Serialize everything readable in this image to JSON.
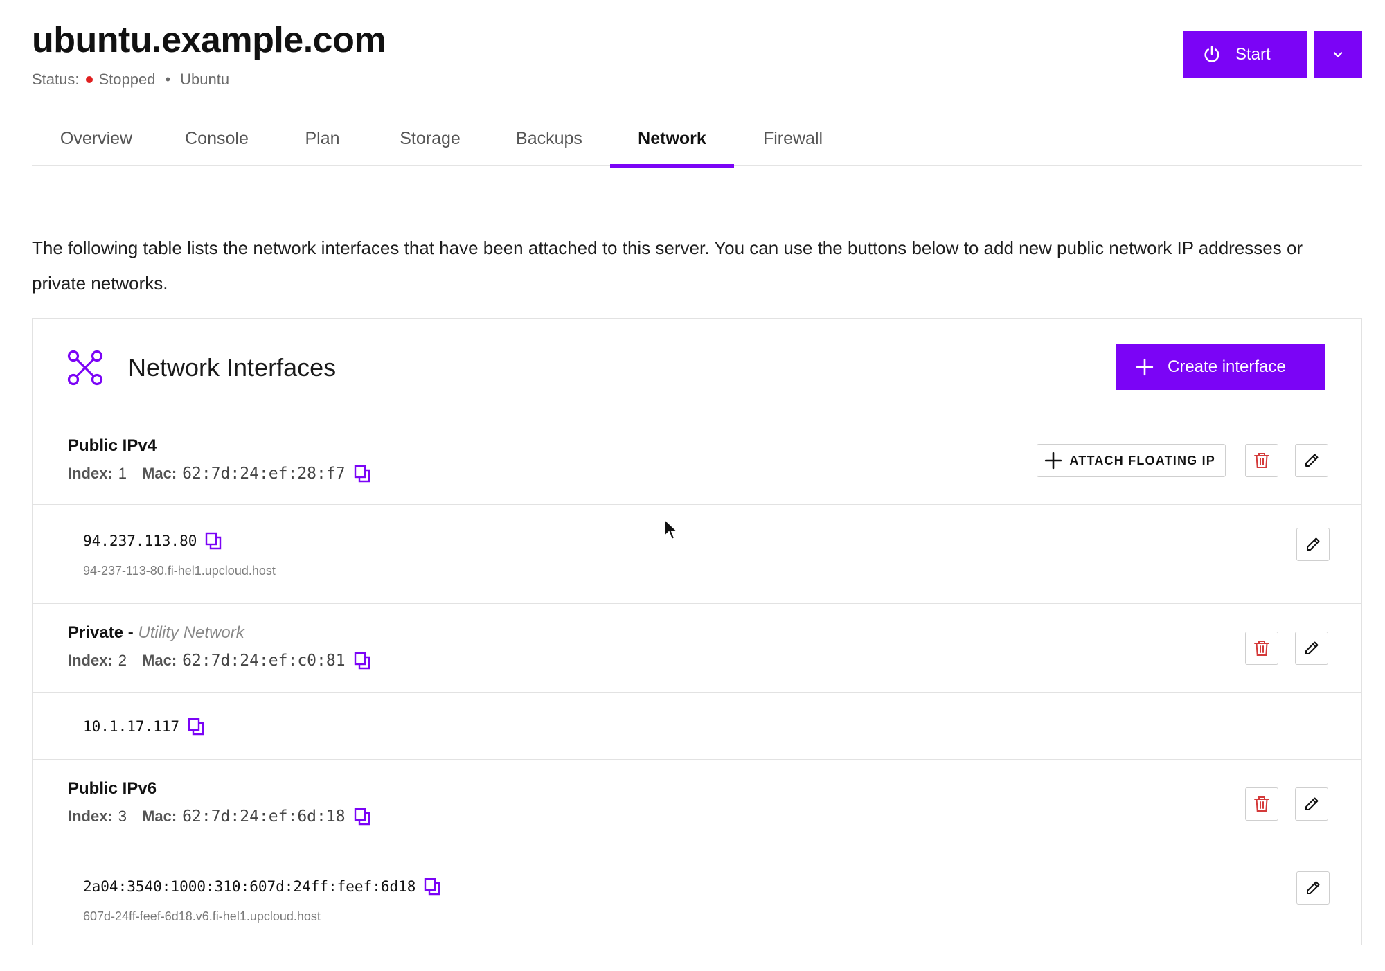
{
  "server": {
    "title": "ubuntu.example.com",
    "status_label": "Status:",
    "status_value": "Stopped",
    "os": "Ubuntu"
  },
  "actions": {
    "start_label": "Start"
  },
  "tabs": [
    {
      "label": "Overview"
    },
    {
      "label": "Console"
    },
    {
      "label": "Plan"
    },
    {
      "label": "Storage"
    },
    {
      "label": "Backups"
    },
    {
      "label": "Network",
      "active": true
    },
    {
      "label": "Firewall"
    }
  ],
  "description": "The following table lists the network interfaces that have been attached to this server. You can use the buttons below to add new public network IP addresses or private networks.",
  "card": {
    "title": "Network Interfaces",
    "create_label": "Create interface"
  },
  "interfaces": [
    {
      "name": "Public IPv4",
      "index_label": "Index:",
      "index": "1",
      "mac_label": "Mac:",
      "mac": "62:7d:24:ef:28:f7",
      "attach_label": "ATTACH FLOATING IP",
      "address": "94.237.113.80",
      "hostname": "94-237-113-80.fi-hel1.upcloud.host"
    },
    {
      "name": "Private - ",
      "subname": "Utility Network",
      "index_label": "Index:",
      "index": "2",
      "mac_label": "Mac:",
      "mac": "62:7d:24:ef:c0:81",
      "address": "10.1.17.117"
    },
    {
      "name": "Public IPv6",
      "index_label": "Index:",
      "index": "3",
      "mac_label": "Mac:",
      "mac": "62:7d:24:ef:6d:18",
      "address": "2a04:3540:1000:310:607d:24ff:feef:6d18",
      "hostname": "607d-24ff-feef-6d18.v6.fi-hel1.upcloud.host"
    }
  ],
  "colors": {
    "accent": "#7b04f6",
    "status_stopped": "#e02020",
    "delete_icon": "#d43a3a"
  }
}
